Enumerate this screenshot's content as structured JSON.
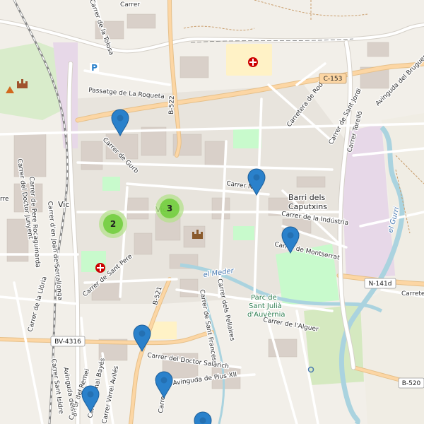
{
  "map": {
    "place_labels": {
      "vic": "Vic",
      "barri": "Barri dels",
      "caputxins": "Caputxins"
    },
    "water_labels": {
      "meder": "el Meder",
      "gurri": "el Gurri"
    },
    "park_labels": {
      "line1": "Parc de",
      "line2": "Sant Julià",
      "line3": "d'Auvèrnia"
    },
    "street_labels": {
      "passatge_roqueta": "Passatge de La Roqueta",
      "b522": "B-522",
      "b521": "B-521",
      "carrer_gurb": "Carrer de Gurb",
      "carrer_nou": "Carrer Nou",
      "carretera_roda": "Carretera de Roda",
      "carrer_sant_jordi": "Carrer de Sant Jordi",
      "carrer_torello": "Carrer Torelló",
      "avinguda_bruguer": "Avinguda del Bruguer",
      "carrer_industria": "Carrer de la Indústria",
      "carrer_montserrat": "Carrer de Montserrat",
      "carrer_sant_pere": "Carrer de Sant Pere",
      "carrer_pellaires": "Carrer dels Pellaires",
      "carrer_sant_francesc": "Carrer de Sant Francesc",
      "carrer_alguer": "Carrer de l'Alguer",
      "carrer_doctor_salarich": "Carrer del Doctor Salarich",
      "avinguda_pius": "Avinguda de Pius XII",
      "carrer_remei": "Carrer del Remei",
      "carrer_sant_isidre": "Carrer Sant Isidre",
      "carrer_canal_bayes": "Carrer Canal Bayés",
      "carrer_virrei_aviles": "Carrer Virrei Avilés",
      "avinguda_dels_p": "Avinguda dels P",
      "carrer_lloria": "Carrer de la Llòria",
      "carrer_doctor_junyent": "Carrer del Doctor Junyent",
      "carrer_pere_roca": "Carrer de Pere Rocaguinarda",
      "carrer_sant_joan": "Carrer d'en Joan de Serrallonga",
      "carrer_tolosa": "Carrer de la Tolosa",
      "carrer_top": "Carrer",
      "carrete": "Carrete",
      "carre_left": "rre",
      "carrer_doctor_partial": "Carre"
    },
    "road_shields": {
      "c153": "C-153",
      "n141d": "N-141d",
      "bv4316": "BV-4316",
      "b520": "B-520"
    },
    "clusters": [
      {
        "count": "3"
      },
      {
        "count": "2"
      }
    ],
    "markers_count": 7,
    "icons": {
      "parking": "P",
      "hospital": "hospital-icon",
      "castle": "castle-icon"
    },
    "colors": {
      "marker": "#2a81cb",
      "cluster_outer": "#b5e28c",
      "cluster_inner": "#6ecc39",
      "water": "#aad3df",
      "park": "#c8facc",
      "railway_land": "#e7d8e8",
      "road_primary": "#fcd6a4",
      "road_minor": "#ffffff"
    }
  }
}
